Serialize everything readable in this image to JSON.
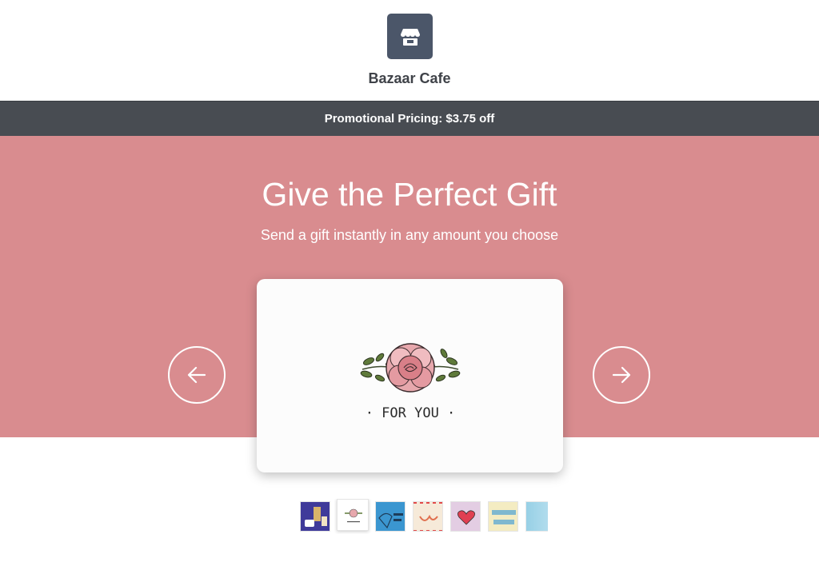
{
  "shop": {
    "name": "Bazaar Cafe",
    "logo_icon": "storefront-icon",
    "brand_color": "#4b5669"
  },
  "promo": {
    "text": "Promotional Pricing: $3.75 off"
  },
  "hero": {
    "title": "Give the Perfect Gift",
    "subtitle": "Send a gift instantly in any amount you choose",
    "background": "#d98c8f"
  },
  "carousel": {
    "prev_icon": "arrow-left-icon",
    "next_icon": "arrow-right-icon",
    "selected_card": {
      "design": "rose-for-you",
      "text": "· FOR YOU ·"
    },
    "thumbnails": [
      {
        "design": "drinks-purple",
        "selected": false
      },
      {
        "design": "rose-for-you",
        "selected": true
      },
      {
        "design": "birthday-treat-blue",
        "selected": false
      },
      {
        "design": "you-airmail",
        "selected": false
      },
      {
        "design": "heart-hands",
        "selected": false
      },
      {
        "design": "thank-you",
        "selected": false
      },
      {
        "design": "blue-partial",
        "selected": false
      }
    ]
  }
}
